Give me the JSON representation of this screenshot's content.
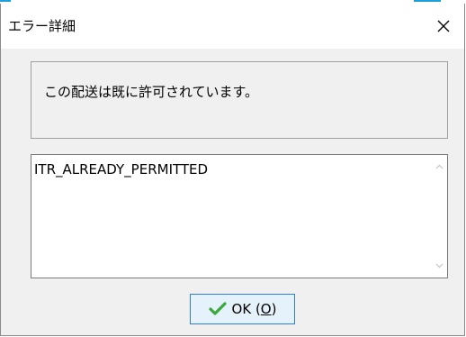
{
  "dialog": {
    "title": "エラー詳細",
    "close_icon": "close-icon",
    "message": "この配送は既に許可されています。",
    "detail_text": "ITR_ALREADY_PERMITTED",
    "ok_button": {
      "label_prefix": "OK (",
      "mnemonic": "O",
      "label_suffix": ")",
      "icon": "checkmark-icon"
    }
  },
  "colors": {
    "accent": "#2e7fd6",
    "check": "#3aa83a",
    "dialog_bg": "#f0f0f0",
    "top_strip": "#1f9fd8"
  }
}
